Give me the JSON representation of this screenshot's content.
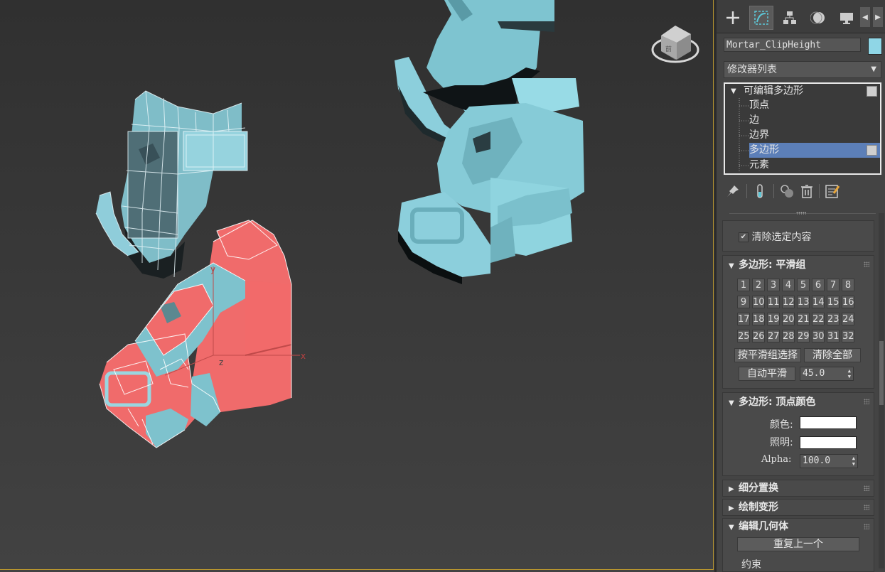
{
  "viewport": {
    "axis_labels": {
      "x": "x",
      "y": "y",
      "z": "z"
    },
    "viewcube_label": "前"
  },
  "command_panel": {
    "tabs": [
      {
        "icon": "plus-icon",
        "name": "create"
      },
      {
        "icon": "modify-icon",
        "name": "modify"
      },
      {
        "icon": "hierarchy-icon",
        "name": "hierarchy"
      },
      {
        "icon": "motion-icon",
        "name": "motion"
      },
      {
        "icon": "display-icon",
        "name": "display"
      }
    ],
    "object_name": "Mortar_ClipHeight",
    "object_color": "#8fd6e6",
    "modifier_list_label": "修改器列表",
    "stack": {
      "root": "可编辑多边形",
      "subs": [
        "顶点",
        "边",
        "边界",
        "多边形",
        "元素"
      ],
      "selected": "多边形"
    },
    "clear_selection_label": "清除选定内容",
    "smoothing": {
      "title": "多边形: 平滑组",
      "groups": [
        "1",
        "2",
        "3",
        "4",
        "5",
        "6",
        "7",
        "8",
        "9",
        "10",
        "11",
        "12",
        "13",
        "14",
        "15",
        "16",
        "17",
        "18",
        "19",
        "20",
        "21",
        "22",
        "23",
        "24",
        "25",
        "26",
        "27",
        "28",
        "29",
        "30",
        "31",
        "32"
      ],
      "select_by_sg": "按平滑组选择",
      "clear_all": "清除全部",
      "auto_smooth": "自动平滑",
      "auto_smooth_value": "45.0"
    },
    "vertex_colors": {
      "title": "多边形: 顶点颜色",
      "color_label": "颜色:",
      "illum_label": "照明:",
      "alpha_label": "Alpha:",
      "alpha_value": "100.0",
      "color": "#ffffff",
      "illum": "#ffffff"
    },
    "collapsed_rollouts": [
      "细分置换",
      "绘制变形"
    ],
    "edit_geometry": {
      "title": "编辑几何体",
      "repeat_last": "重复上一个",
      "constraints": "约束"
    }
  }
}
